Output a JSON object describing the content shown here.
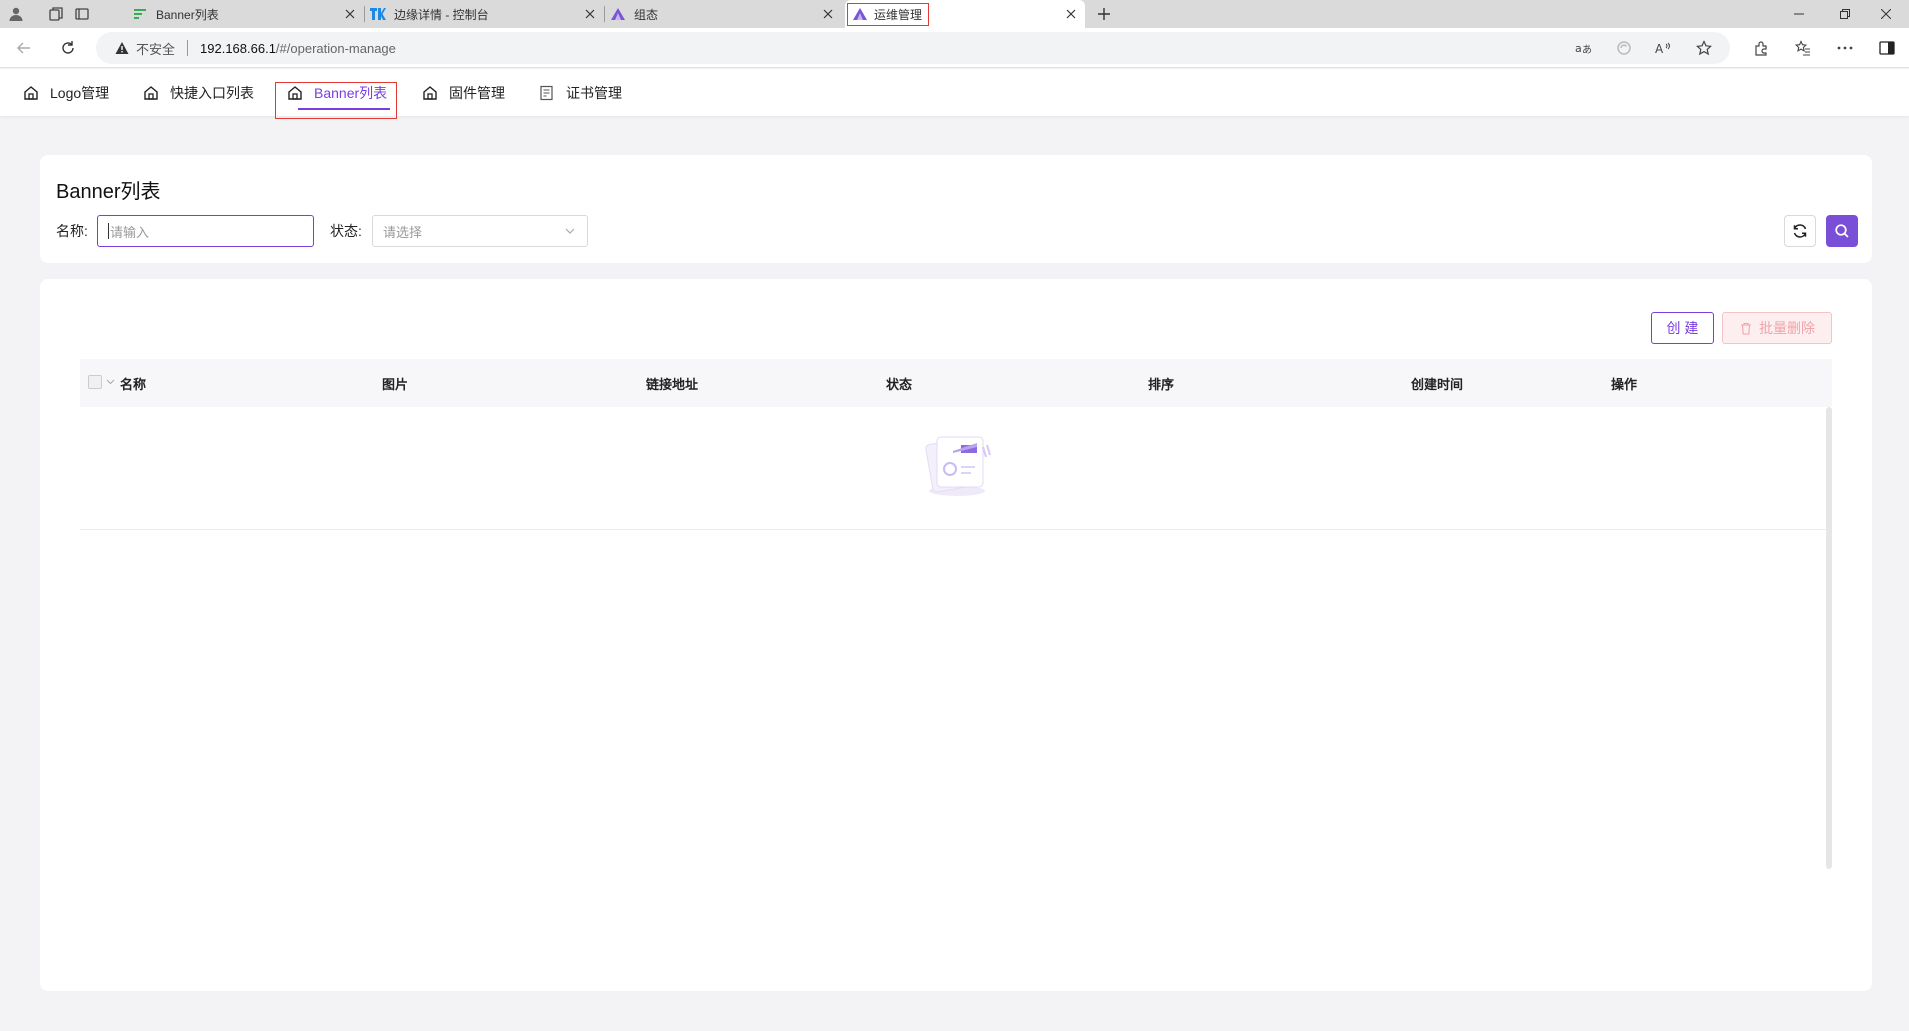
{
  "browser": {
    "tabs": [
      {
        "title": "Banner列表"
      },
      {
        "title": "边缘详情 - 控制台"
      },
      {
        "title": "组态"
      },
      {
        "title": "运维管理"
      }
    ],
    "address": {
      "security_label": "不安全",
      "url_host": "192.168.66.1",
      "url_path": "/#/operation-manage"
    },
    "omnibox_icons": [
      "translate-icon",
      "refresh-circle-icon",
      "read-aloud-icon",
      "favorite-star-icon"
    ],
    "toolbar_icons": [
      "extensions-icon",
      "favorites-icon",
      "more-icon",
      "sidebar-icon"
    ]
  },
  "app_nav": {
    "items": [
      {
        "label": "Logo管理"
      },
      {
        "label": "快捷入口列表"
      },
      {
        "label": "Banner列表"
      },
      {
        "label": "固件管理"
      },
      {
        "label": "证书管理"
      }
    ],
    "active_index": 2
  },
  "search": {
    "title": "Banner列表",
    "name_label": "名称:",
    "name_placeholder": "请输入",
    "status_label": "状态:",
    "status_placeholder": "请选择"
  },
  "toolbar": {
    "create_label": "创 建",
    "bulk_delete_label": "批量删除"
  },
  "table": {
    "columns": [
      "名称",
      "图片",
      "链接地址",
      "状态",
      "排序",
      "创建时间",
      "操作"
    ],
    "rows": []
  },
  "colors": {
    "accent": "#7a3de1",
    "danger_soft": "#f0a3aa",
    "highlight_box": "#e53935"
  }
}
